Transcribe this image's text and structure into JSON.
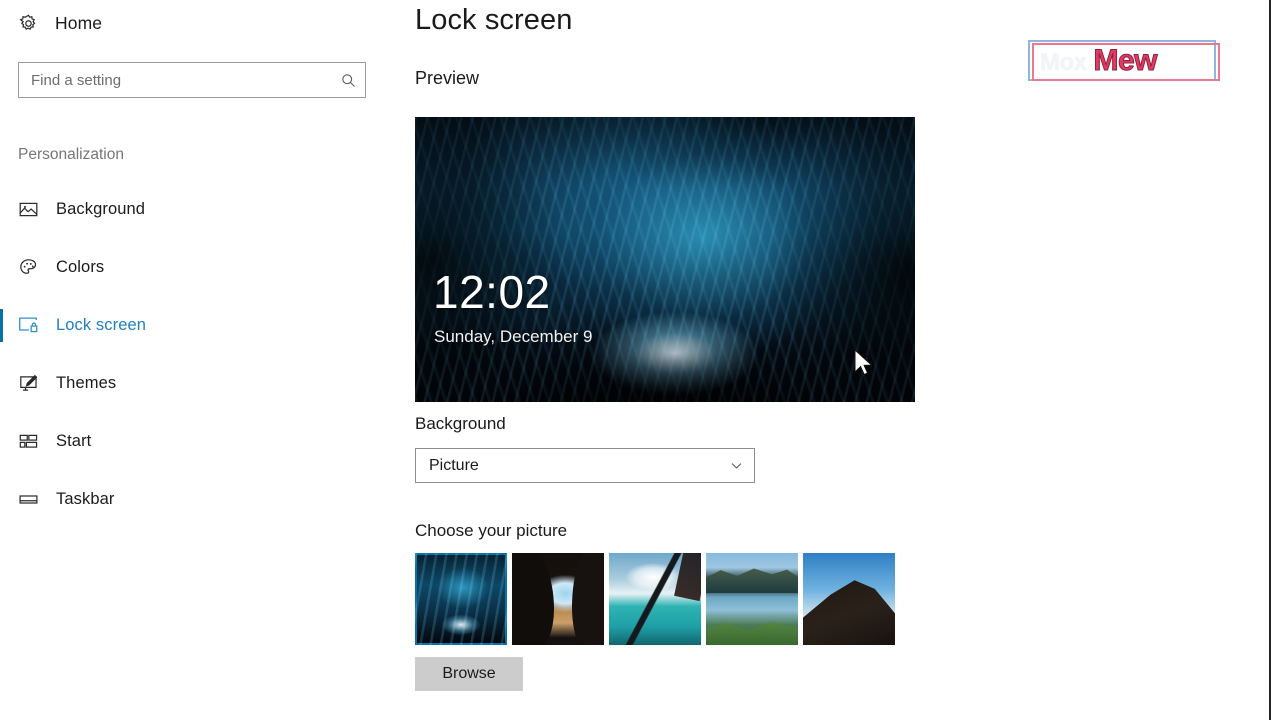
{
  "sidebar": {
    "home": {
      "label": "Home",
      "icon": "gear-icon"
    },
    "search": {
      "value": "",
      "placeholder": "Find a setting",
      "icon": "search-icon"
    },
    "group_title": "Personalization",
    "items": [
      {
        "label": "Background",
        "icon": "picture-icon",
        "selected": false
      },
      {
        "label": "Colors",
        "icon": "palette-icon",
        "selected": false
      },
      {
        "label": "Lock screen",
        "icon": "monitor-lock-icon",
        "selected": true
      },
      {
        "label": "Themes",
        "icon": "brush-monitor-icon",
        "selected": false
      },
      {
        "label": "Start",
        "icon": "start-tiles-icon",
        "selected": false
      },
      {
        "label": "Taskbar",
        "icon": "taskbar-icon",
        "selected": false
      }
    ]
  },
  "main": {
    "page_title": "Lock screen",
    "preview_label": "Preview",
    "preview": {
      "time": "12:02",
      "date": "Sunday, December 9",
      "cursor": "mouse-pointer-icon"
    },
    "background_field": {
      "label": "Background",
      "selected_value": "Picture",
      "chevron": "chevron-down-icon"
    },
    "choose_picture": {
      "label": "Choose your picture",
      "thumbnails": [
        {
          "name": "ice-cave",
          "selected": true
        },
        {
          "name": "beach-cave",
          "selected": false
        },
        {
          "name": "turquoise-sea",
          "selected": false
        },
        {
          "name": "mountain-lake",
          "selected": false
        },
        {
          "name": "ridge-clouds",
          "selected": false
        }
      ],
      "browse_label": "Browse"
    }
  },
  "watermark": {
    "faded_text": "Mox",
    "bold_text": "Mew"
  },
  "colors": {
    "accent": "#0a71a8",
    "selected_text": "#1f7fc0",
    "group_title": "#767676",
    "button_face": "#cccccc",
    "watermark_pink": "#e23a63",
    "watermark_blue": "#93b4dd"
  }
}
